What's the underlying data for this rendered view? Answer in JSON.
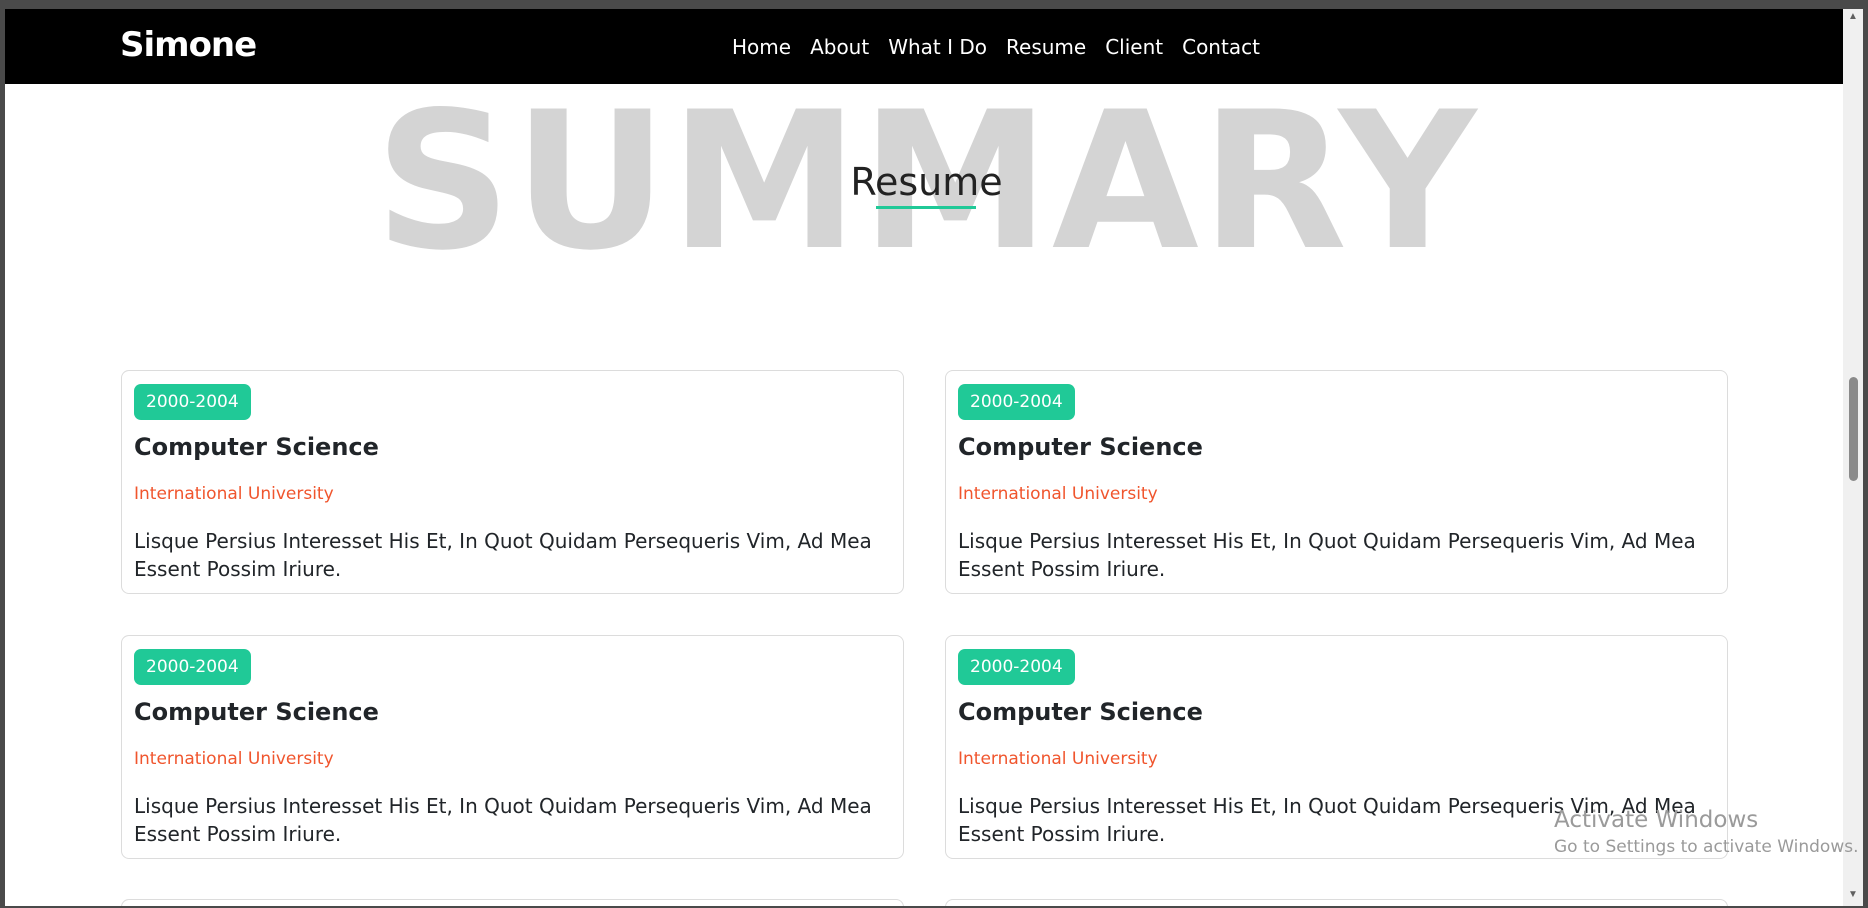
{
  "navbar": {
    "brand": "Simone",
    "links": [
      "Home",
      "About",
      "What I Do",
      "Resume",
      "Client",
      "Contact"
    ]
  },
  "section": {
    "background_title": "SUMMARY",
    "title": "Resume"
  },
  "cards": [
    {
      "period": "2000-2004",
      "title": "Computer Science",
      "institution": "International University",
      "description": "Lisque Persius Interesset His Et, In Quot Quidam Persequeris Vim, Ad Mea Essent Possim Iriure."
    },
    {
      "period": "2000-2004",
      "title": "Computer Science",
      "institution": "International University",
      "description": "Lisque Persius Interesset His Et, In Quot Quidam Persequeris Vim, Ad Mea Essent Possim Iriure."
    },
    {
      "period": "2000-2004",
      "title": "Computer Science",
      "institution": "International University",
      "description": "Lisque Persius Interesset His Et, In Quot Quidam Persequeris Vim, Ad Mea Essent Possim Iriure."
    },
    {
      "period": "2000-2004",
      "title": "Computer Science",
      "institution": "International University",
      "description": "Lisque Persius Interesset His Et, In Quot Quidam Persequeris Vim, Ad Mea Essent Possim Iriure."
    }
  ],
  "watermark": {
    "title": "Activate Windows",
    "subtitle": "Go to Settings to activate Windows."
  },
  "colors": {
    "accent": "#20c997",
    "institution": "#f0552d",
    "navbar_bg": "#000000",
    "background_title": "#d4d4d4"
  }
}
